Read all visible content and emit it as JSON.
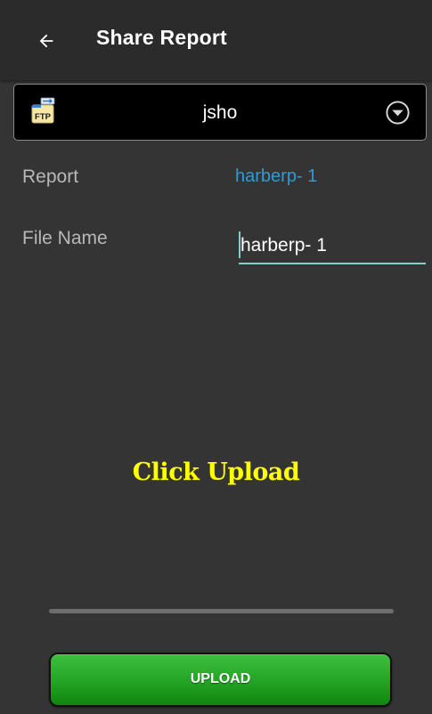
{
  "toolbar": {
    "title": "Share Report",
    "back_icon": "arrow-left-icon"
  },
  "destination": {
    "icon": "ftp-icon",
    "icon_text": "FTP",
    "value": "jsho",
    "dropdown_icon": "chevron-down-circle-icon"
  },
  "report": {
    "label": "Report",
    "value": "harberp- 1"
  },
  "file_name": {
    "label": "File Name",
    "value": "harberp- 1"
  },
  "hint": {
    "text": "Click Upload",
    "color": "#ffff00"
  },
  "progress": {
    "value": 0
  },
  "upload_button": {
    "label": "UPLOAD",
    "color": "#26a626"
  },
  "colors": {
    "background": "#343434",
    "toolbar": "#2b2b2b",
    "accent_link": "#2f9bd6",
    "input_underline": "#7fd0cb"
  }
}
